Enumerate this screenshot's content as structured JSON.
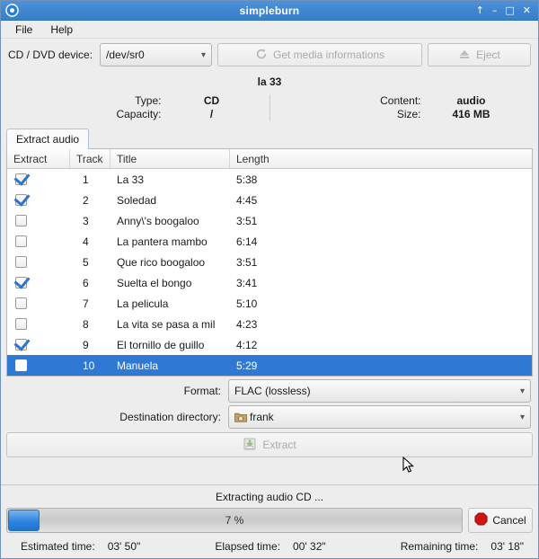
{
  "window": {
    "title": "simpleburn",
    "icon": "disc-icon",
    "buttons": [
      {
        "name": "shade-button",
        "glyph": "↑"
      },
      {
        "name": "minimize-button",
        "glyph": "–"
      },
      {
        "name": "maximize-button",
        "glyph": "□"
      },
      {
        "name": "close-button",
        "glyph": "✕"
      }
    ]
  },
  "menu": {
    "file": "File",
    "help": "Help"
  },
  "toolbar": {
    "device_label": "CD / DVD device:",
    "device_value": "/dev/sr0",
    "get_media_label": "Get media informations",
    "eject_label": "Eject"
  },
  "media": {
    "disc_title": "la 33",
    "type_label": "Type:",
    "type_value": "CD",
    "capacity_label": "Capacity:",
    "capacity_value": "/",
    "content_label": "Content:",
    "content_value": "audio",
    "size_label": "Size:",
    "size_value": "416 MB"
  },
  "tab": {
    "label": "Extract audio"
  },
  "table": {
    "columns": [
      "Extract",
      "Track",
      "Title",
      "Length"
    ],
    "rows": [
      {
        "checked": true,
        "track": "1",
        "title": "La 33",
        "length": "5:38",
        "selected": false
      },
      {
        "checked": true,
        "track": "2",
        "title": "Soledad",
        "length": "4:45",
        "selected": false
      },
      {
        "checked": false,
        "track": "3",
        "title": "Anny\\'s boogaloo",
        "length": "3:51",
        "selected": false
      },
      {
        "checked": false,
        "track": "4",
        "title": "La pantera mambo",
        "length": "6:14",
        "selected": false
      },
      {
        "checked": false,
        "track": "5",
        "title": "Que rico boogaloo",
        "length": "3:51",
        "selected": false
      },
      {
        "checked": true,
        "track": "6",
        "title": "Suelta el bongo",
        "length": "3:41",
        "selected": false
      },
      {
        "checked": false,
        "track": "7",
        "title": "La pelicula",
        "length": "5:10",
        "selected": false
      },
      {
        "checked": false,
        "track": "8",
        "title": "La vita se pasa a mil",
        "length": "4:23",
        "selected": false
      },
      {
        "checked": true,
        "track": "9",
        "title": "El tornillo de guillo",
        "length": "4:12",
        "selected": false
      },
      {
        "checked": false,
        "track": "10",
        "title": "Manuela",
        "length": "5:29",
        "selected": true
      }
    ]
  },
  "options": {
    "format_label": "Format:",
    "format_value": "FLAC (lossless)",
    "destination_label": "Destination directory:",
    "destination_value": "frank",
    "extract_label": "Extract"
  },
  "status": {
    "message": "Extracting audio CD ...",
    "progress_percent": 7,
    "progress_text": "7 %",
    "cancel_label": "Cancel",
    "estimated_label": "Estimated time:",
    "estimated_value": "03' 50\"",
    "elapsed_label": "Elapsed time:",
    "elapsed_value": "00' 32\"",
    "remaining_label": "Remaining time:",
    "remaining_value": "03' 18\""
  },
  "colors": {
    "titlebar": "#3f86d0",
    "selection": "#2f79d4",
    "progress_fill": "#2f84e0",
    "cancel_icon": "#d01414"
  }
}
